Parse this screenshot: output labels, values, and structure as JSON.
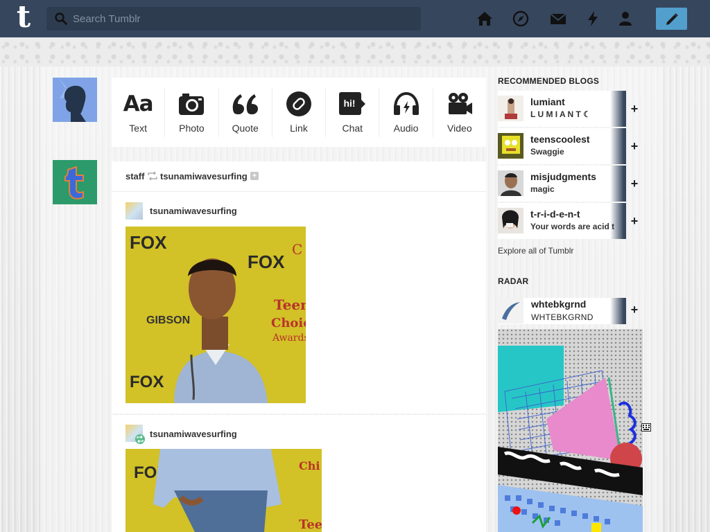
{
  "header": {
    "logo": "t",
    "search_placeholder": "Search Tumblr",
    "nav_icons": [
      "home-icon",
      "explore-icon",
      "inbox-icon",
      "activity-icon",
      "account-icon"
    ],
    "compose_icon": "pencil-icon",
    "bg_color": "#36465d",
    "accent_color": "#529ecc"
  },
  "post_types": [
    {
      "label": "Text",
      "icon": "text-icon",
      "glyph": "Aa"
    },
    {
      "label": "Photo",
      "icon": "camera-icon"
    },
    {
      "label": "Quote",
      "icon": "quote-icon"
    },
    {
      "label": "Link",
      "icon": "link-icon"
    },
    {
      "label": "Chat",
      "icon": "chat-icon",
      "glyph": "hi!"
    },
    {
      "label": "Audio",
      "icon": "headphones-icon"
    },
    {
      "label": "Video",
      "icon": "video-camera-icon"
    }
  ],
  "posts": [
    {
      "reblogged_by": "staff",
      "reblogged_from": "tsunamiwavesurfing",
      "author": "tsunamiwavesurfing"
    },
    {
      "author": "tsunamiwavesurfing"
    }
  ],
  "sidebar": {
    "recommended_title": "RECOMMENDED BLOGS",
    "recommended": [
      {
        "name": "lumiant",
        "subtitle": "L U M I A N T ☾"
      },
      {
        "name": "teenscoolest",
        "subtitle": "Swaggie"
      },
      {
        "name": "misjudgments",
        "subtitle": "magic"
      },
      {
        "name": "t-r-i-d-e-n-t",
        "subtitle": "Your words are acid t"
      }
    ],
    "explore_link": "Explore all of Tumblr",
    "radar_title": "RADAR",
    "radar": {
      "name": "whtebkgrnd",
      "subtitle": "WHTEBKGRND"
    },
    "follow_label": "+"
  }
}
